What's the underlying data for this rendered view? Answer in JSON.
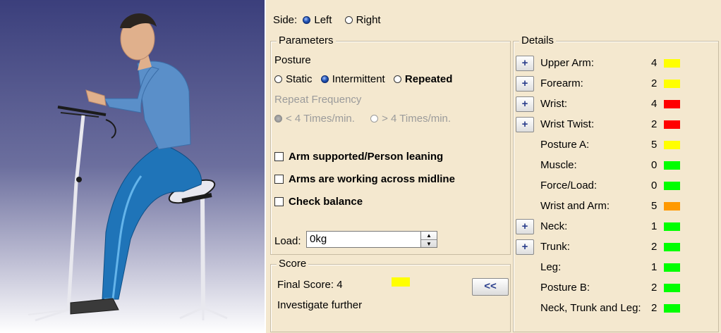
{
  "side": {
    "label": "Side:",
    "options": [
      "Left",
      "Right"
    ],
    "selected": "Left"
  },
  "parameters": {
    "title": "Parameters",
    "posture_label": "Posture",
    "posture_options": [
      "Static",
      "Intermittent",
      "Repeated"
    ],
    "posture_selected": "Intermittent",
    "repeat_label": "Repeat Frequency",
    "repeat_options": [
      "< 4 Times/min.",
      "> 4 Times/min."
    ],
    "checkboxes": [
      "Arm supported/Person leaning",
      "Arms are working across midline",
      "Check balance"
    ],
    "load_label": "Load:",
    "load_value": "0kg"
  },
  "score": {
    "title": "Score",
    "final_label": "Final Score: 4",
    "final_color": "#ffff00",
    "message": "Investigate further",
    "collapse_label": "<<"
  },
  "details": {
    "title": "Details",
    "rows": [
      {
        "label": "Upper Arm:",
        "value": "4",
        "color": "#ffff00",
        "expandable": true
      },
      {
        "label": "Forearm:",
        "value": "2",
        "color": "#ffff00",
        "expandable": true
      },
      {
        "label": "Wrist:",
        "value": "4",
        "color": "#ff0000",
        "expandable": true
      },
      {
        "label": "Wrist Twist:",
        "value": "2",
        "color": "#ff0000",
        "expandable": true
      },
      {
        "label": "Posture A:",
        "value": "5",
        "color": "#ffff00",
        "expandable": false
      },
      {
        "label": "Muscle:",
        "value": "0",
        "color": "#00ff00",
        "expandable": false
      },
      {
        "label": "Force/Load:",
        "value": "0",
        "color": "#00ff00",
        "expandable": false
      },
      {
        "label": "Wrist and Arm:",
        "value": "5",
        "color": "#ff9900",
        "expandable": false
      },
      {
        "label": "Neck:",
        "value": "1",
        "color": "#00ff00",
        "expandable": true
      },
      {
        "label": "Trunk:",
        "value": "2",
        "color": "#00ff00",
        "expandable": true
      },
      {
        "label": "Leg:",
        "value": "1",
        "color": "#00ff00",
        "expandable": false
      },
      {
        "label": "Posture B:",
        "value": "2",
        "color": "#00ff00",
        "expandable": false
      },
      {
        "label": "Neck, Trunk and Leg:",
        "value": "2",
        "color": "#00ff00",
        "expandable": false
      }
    ],
    "plus_label": "+"
  }
}
